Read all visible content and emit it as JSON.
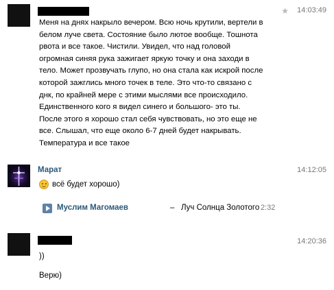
{
  "messages": [
    {
      "time": "14:03:49",
      "text": "Меня на днях накрыло вечером. Всю ночь крутили, вертели в\nбелом луче света. Состояние было лютое вообще. Тошнота\nрвота и все такое. Чистили. Увидел, что над головой\nогромная синяя рука зажигает яркую точку и она заходи в\nтело. Может прозвучать глупо, но она стала как искрой после\nкоторой зажглись много точек в теле. Это что-то связано с\nднк, по крайней мере с этими мыслями все происходило.\nЕдинственного кого я видел синего и большого- это ты.\nПосле этого я хорошо стал себя чувствовать, но это еще не\nвсе. Слышал, что еще около 6-7 дней будет накрывать.\nТемпература и все такое"
    },
    {
      "sender": "Марат",
      "time": "14:12:05",
      "text": "всё будет хорошо)",
      "audio": {
        "artist": "Муслим Магомаев",
        "separator": "–",
        "title": "Луч Солнца Золотого",
        "duration": "2:32"
      }
    },
    {
      "time": "14:20:36",
      "lines": [
        "))",
        "Верю)"
      ]
    }
  ],
  "icons": {
    "star": "star-icon",
    "smile": "smile-emoji-icon",
    "play": "play-icon"
  },
  "colors": {
    "link": "#2b587a",
    "timestamp": "#777777",
    "play_button": "#5e82a8"
  }
}
